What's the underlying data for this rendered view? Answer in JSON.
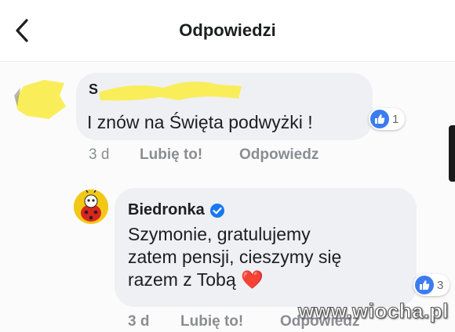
{
  "header": {
    "title": "Odpowiedzi",
    "back_icon": "chevron-left-icon"
  },
  "comment1": {
    "author": "S",
    "text": "I znów na Święta podwyżki !",
    "reactions": {
      "icon": "like-icon",
      "count": "1"
    },
    "time": "3 d",
    "like_label": "Lubię to!",
    "reply_label": "Odpowiedz"
  },
  "comment2": {
    "author": "Biedronka",
    "verified_icon": "verified-badge-icon",
    "text_lines": [
      "Szymonie, gratulujemy",
      "zatem pensji, cieszymy się",
      "razem z Tobą"
    ],
    "emoji": "❤️",
    "reactions": {
      "icon": "like-icon",
      "count": "3"
    },
    "time": "3 d",
    "like_label": "Lubię to!",
    "reply_label": "Odpowiedz"
  },
  "watermark": "www.wiocha.pl",
  "colors": {
    "like_blue": "#3b7cf0",
    "verified_blue": "#1877f2",
    "bubble": "#eef0f3",
    "redaction_yellow": "#f9ee5a"
  }
}
